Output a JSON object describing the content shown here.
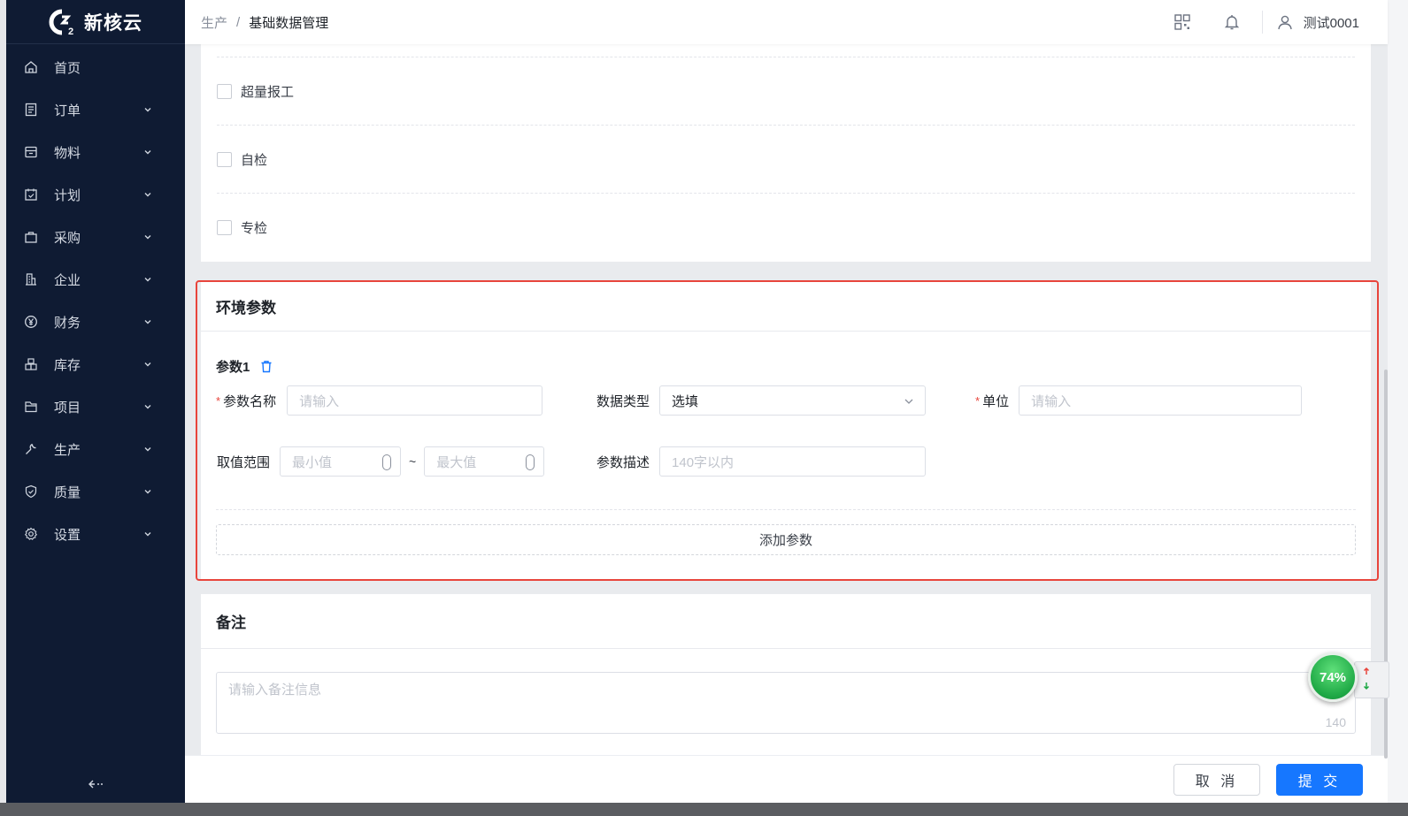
{
  "app": {
    "logo_text": "新核云"
  },
  "sidebar": {
    "items": [
      {
        "label": "首页",
        "icon": "home-icon"
      },
      {
        "label": "订单",
        "icon": "order-icon"
      },
      {
        "label": "物料",
        "icon": "material-icon"
      },
      {
        "label": "计划",
        "icon": "plan-icon"
      },
      {
        "label": "采购",
        "icon": "purchase-bag-icon"
      },
      {
        "label": "企业",
        "icon": "building-icon"
      },
      {
        "label": "财务",
        "icon": "yen-icon"
      },
      {
        "label": "库存",
        "icon": "inventory-icon"
      },
      {
        "label": "项目",
        "icon": "folder-icon"
      },
      {
        "label": "生产",
        "icon": "wrench-icon"
      },
      {
        "label": "质量",
        "icon": "shield-check-icon"
      },
      {
        "label": "设置",
        "icon": "gear-icon"
      }
    ]
  },
  "header": {
    "breadcrumb": [
      "生产",
      "基础数据管理"
    ],
    "separator": "/",
    "username": "测试0001"
  },
  "checks": {
    "items": [
      {
        "label": "超量报工",
        "checked": false
      },
      {
        "label": "自检",
        "checked": false
      },
      {
        "label": "专检",
        "checked": false
      }
    ]
  },
  "env": {
    "title": "环境参数",
    "param_label": "参数1",
    "name_label": "参数名称",
    "name_placeholder": "请输入",
    "type_label": "数据类型",
    "type_value": "选填",
    "unit_label": "单位",
    "unit_placeholder": "请输入",
    "range_label": "取值范围",
    "min_placeholder": "最小值",
    "range_sep": "~",
    "max_placeholder": "最大值",
    "desc_label": "参数描述",
    "desc_placeholder": "140字以内",
    "add_label": "添加参数",
    "required_mark": "*"
  },
  "remark": {
    "title": "备注",
    "placeholder": "请输入备注信息",
    "counter": "140"
  },
  "footer": {
    "cancel": "取 消",
    "submit": "提 交"
  },
  "widget": {
    "percent": "74%"
  },
  "colors": {
    "sidebar_bg": "#0f1b33",
    "primary": "#1677ff",
    "highlight": "#e8453c",
    "required": "#e8453c"
  }
}
